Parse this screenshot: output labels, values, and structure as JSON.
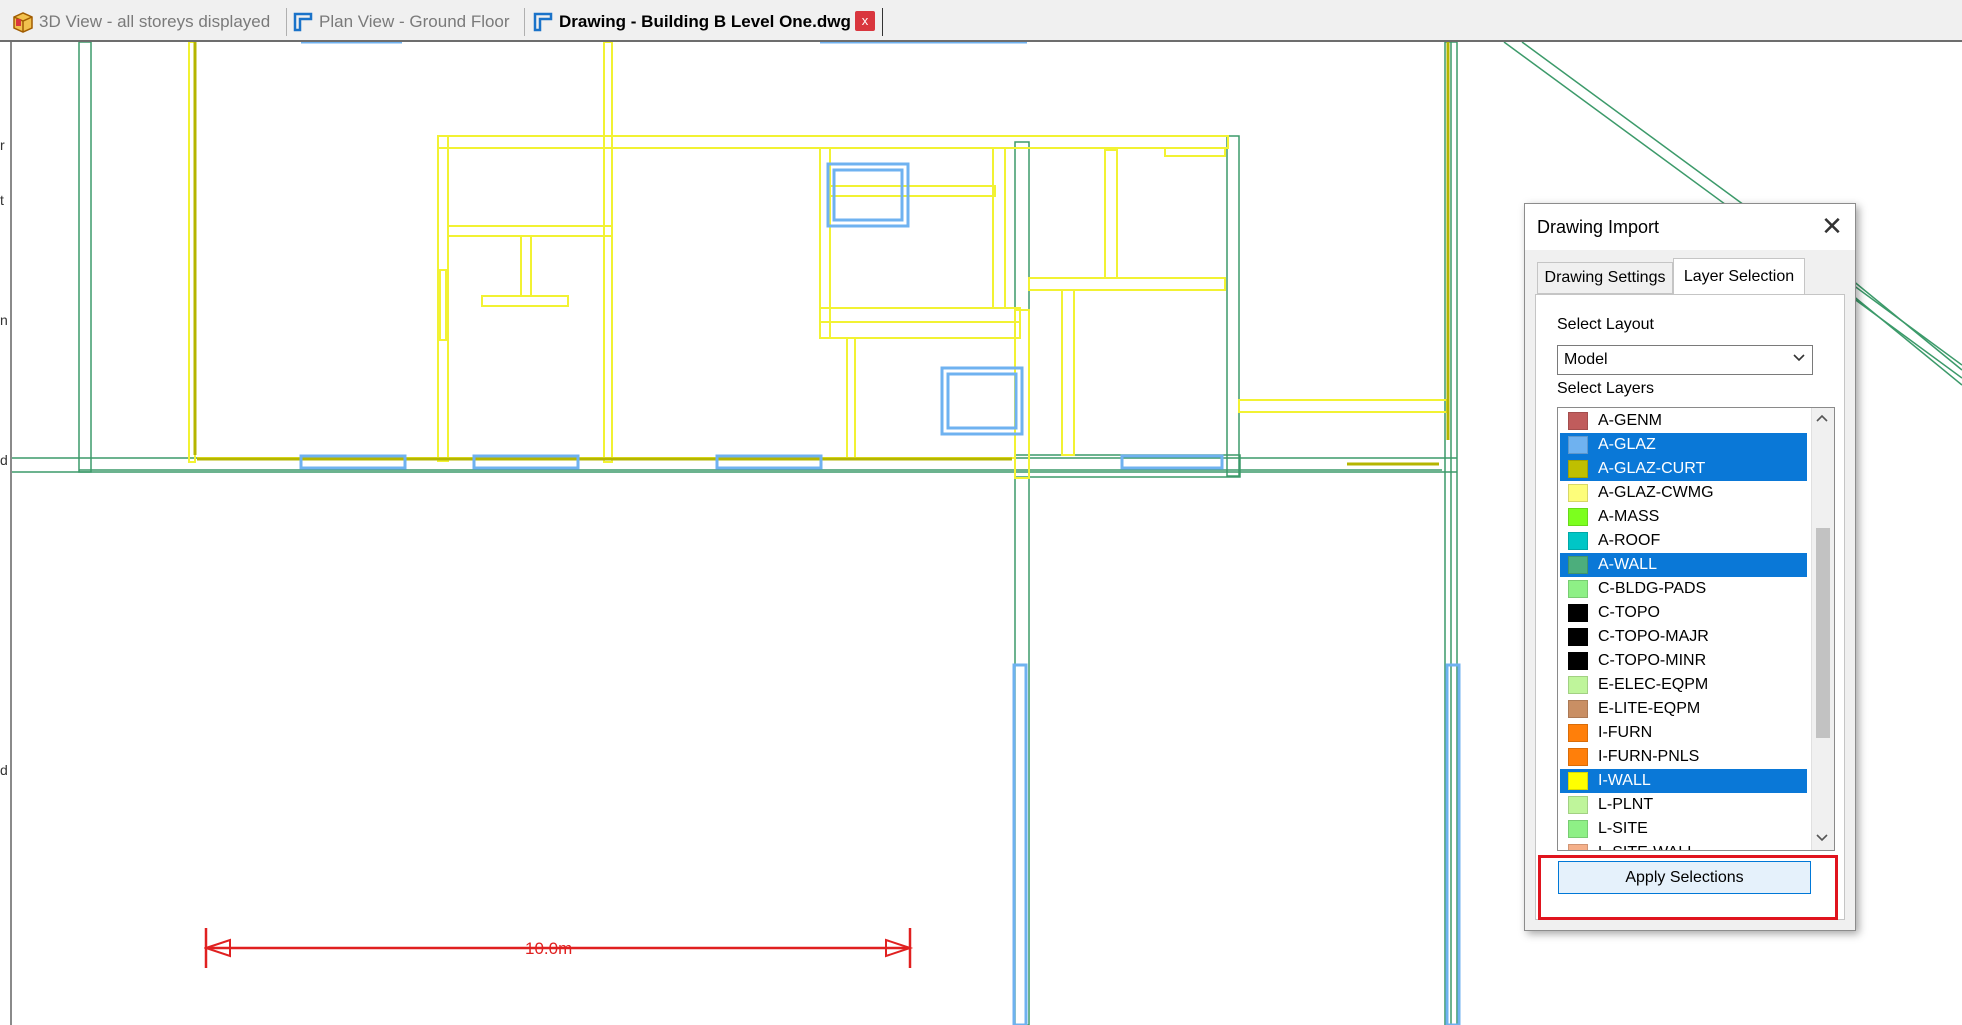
{
  "tabs": [
    {
      "label": "3D View - all storeys displayed",
      "icon": "cube-icon",
      "active": false
    },
    {
      "label": "Plan View - Ground Floor",
      "icon": "plan-view-icon",
      "active": false
    },
    {
      "label": "Drawing - Building B Level One.dwg",
      "icon": "drawing-icon",
      "active": true
    }
  ],
  "close_tab_label": "x",
  "left_strip_chars": [
    "r",
    "t",
    "n",
    "d",
    "d"
  ],
  "scale_bar": {
    "label": "10.0m",
    "color": "#e02020"
  },
  "dialog": {
    "title": "Drawing Import",
    "close_label": "✕",
    "tabs": [
      {
        "label": "Drawing Settings",
        "active": false
      },
      {
        "label": "Layer Selection",
        "active": true
      }
    ],
    "select_layout_label": "Select Layout",
    "layout_value": "Model",
    "select_layers_label": "Select Layers",
    "layers": [
      {
        "name": "A-GENM",
        "color": "#c05c5c",
        "selected": false
      },
      {
        "name": "A-GLAZ",
        "color": "#6fb2f0",
        "selected": true
      },
      {
        "name": "A-GLAZ-CURT",
        "color": "#bfbf00",
        "selected": true
      },
      {
        "name": "A-GLAZ-CWMG",
        "color": "#fdfd7a",
        "selected": false
      },
      {
        "name": "A-MASS",
        "color": "#7cff1e",
        "selected": false
      },
      {
        "name": "A-ROOF",
        "color": "#00c6c6",
        "selected": false
      },
      {
        "name": "A-WALL",
        "color": "#4cae7c",
        "selected": true
      },
      {
        "name": "C-BLDG-PADS",
        "color": "#8ef086",
        "selected": false
      },
      {
        "name": "C-TOPO",
        "color": "#000000",
        "selected": false
      },
      {
        "name": "C-TOPO-MAJR",
        "color": "#000000",
        "selected": false
      },
      {
        "name": "C-TOPO-MINR",
        "color": "#000000",
        "selected": false
      },
      {
        "name": "E-ELEC-EQPM",
        "color": "#bff59b",
        "selected": false
      },
      {
        "name": "E-LITE-EQPM",
        "color": "#c98f64",
        "selected": false
      },
      {
        "name": "I-FURN",
        "color": "#ff7f0a",
        "selected": false
      },
      {
        "name": "I-FURN-PNLS",
        "color": "#ff7f0a",
        "selected": false
      },
      {
        "name": "I-WALL",
        "color": "#ffff00",
        "selected": true
      },
      {
        "name": "L-PLNT",
        "color": "#bff59b",
        "selected": false
      },
      {
        "name": "L-SITE",
        "color": "#8ef086",
        "selected": false
      },
      {
        "name": "L-SITE-WALL",
        "color": "#f5b08a",
        "selected": false
      }
    ],
    "apply_label": "Apply Selections"
  }
}
